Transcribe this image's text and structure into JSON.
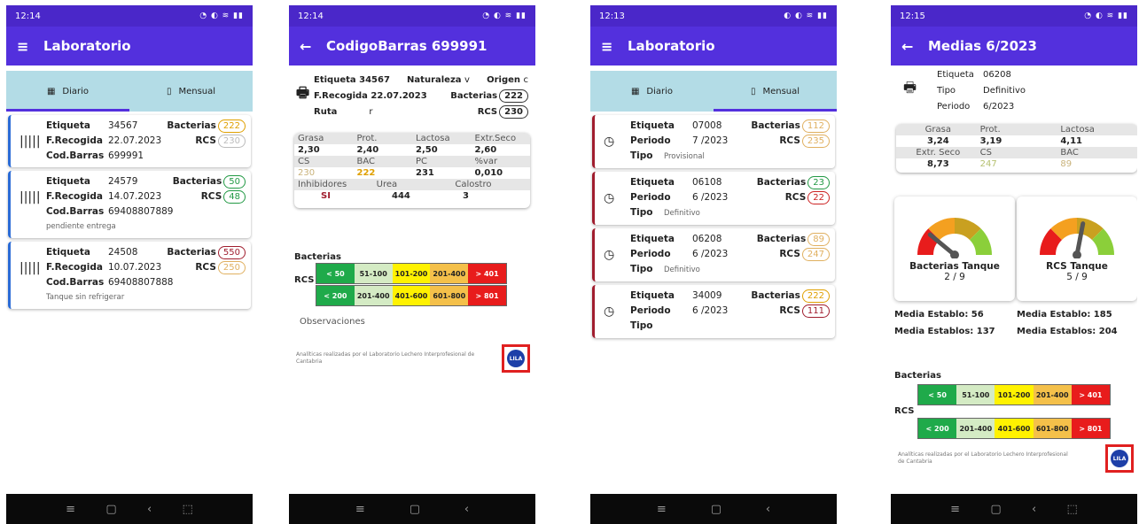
{
  "colors": {
    "primary": "#5330dd",
    "status": "#4a27c9",
    "tabbg": "#b3dce6"
  },
  "icons": {
    "menu": "≡",
    "back": "←",
    "nav_recent": "≡",
    "nav_home": "▢",
    "nav_back": "‹"
  },
  "p1": {
    "time": "12:14",
    "title": "Laboratorio",
    "tab_daily": "Diario",
    "tab_monthly": "Mensual",
    "cards": [
      {
        "etiqueta": "34567",
        "fecha": "22.07.2023",
        "codbarras": "699991",
        "bac": "222",
        "rcs": "230",
        "bac_color": "#e0a000",
        "rcs_color": "#bbb",
        "note": ""
      },
      {
        "etiqueta": "24579",
        "fecha": "14.07.2023",
        "codbarras": "69408807889",
        "bac": "50",
        "rcs": "48",
        "bac_color": "#229944",
        "rcs_color": "#229944",
        "note": "pendiente entrega"
      },
      {
        "etiqueta": "24508",
        "fecha": "10.07.2023",
        "codbarras": "69408807888",
        "bac": "550",
        "rcs": "250",
        "bac_color": "#a01d2e",
        "rcs_color": "#e0b060",
        "note": "Tanque sin refrigerar"
      }
    ]
  },
  "labels": {
    "etiqueta": "Etiqueta",
    "frecogida": "F.Recogida",
    "codbarras": "Cod.Barras",
    "bacterias": "Bacterias",
    "rcs": "RCS",
    "periodo": "Periodo",
    "tipo": "Tipo",
    "naturaleza": "Naturaleza",
    "origen": "Origen",
    "ruta": "Ruta",
    "observaciones": "Observaciones",
    "footer": "Analíticas realizadas por el Laboratorio Lechero Interprofesional de Cantabria",
    "lila": "LILA"
  },
  "p2": {
    "time": "12:14",
    "title": "CodigoBarras 699991",
    "etiqueta": "Etiqueta 34567",
    "naturaleza_val": "v",
    "origen_val": "c",
    "fecha": "F.Recogida 22.07.2023",
    "ruta_val": "r",
    "bac": "222",
    "rcs": "230",
    "h1": [
      "Grasa",
      "Prot.",
      "Lactosa",
      "Extr.Seco"
    ],
    "v1": [
      "2,30",
      "2,40",
      "2,50",
      "2,60"
    ],
    "h2": [
      "CS",
      "BAC",
      "PC",
      "%var"
    ],
    "v2": [
      "230",
      "222",
      "231",
      "0,010"
    ],
    "h3": [
      "Inhibidores",
      "Urea",
      "Calostro"
    ],
    "v3": [
      "SI",
      "444",
      "3"
    ]
  },
  "scales": {
    "bacterias": [
      "< 50",
      "51-100",
      "101-200",
      "201-400",
      "> 401"
    ],
    "rcs": [
      "< 200",
      "201-400",
      "401-600",
      "601-800",
      "> 801"
    ],
    "colors": [
      "#1faa4a",
      "#d4ebc4",
      "#fff200",
      "#f4c04a",
      "#e81c1c"
    ]
  },
  "p3": {
    "time": "12:13",
    "title": "Laboratorio",
    "cards": [
      {
        "etiqueta": "07008",
        "periodo": "7 /2023",
        "tipo": "Provisional",
        "bac": "112",
        "rcs": "235",
        "bac_color": "#e0b060",
        "rcs_color": "#e0b060"
      },
      {
        "etiqueta": "06108",
        "periodo": "6 /2023",
        "tipo": "Definitivo",
        "bac": "23",
        "rcs": "22",
        "bac_color": "#229944",
        "rcs_color": "#cc2222"
      },
      {
        "etiqueta": "06208",
        "periodo": "6 /2023",
        "tipo": "Definitivo",
        "bac": "89",
        "rcs": "247",
        "bac_color": "#e0b060",
        "rcs_color": "#e0b060"
      },
      {
        "etiqueta": "34009",
        "periodo": "6 /2023",
        "tipo": "",
        "bac": "222",
        "rcs": "111",
        "bac_color": "#e0a000",
        "rcs_color": "#a01d2e"
      }
    ]
  },
  "p4": {
    "time": "12:15",
    "title": "Medias 6/2023",
    "etiqueta": "06208",
    "tipo": "Definitivo",
    "periodo": "6/2023",
    "h1": [
      "Grasa",
      "Prot.",
      "Lactosa"
    ],
    "v1": [
      "3,24",
      "3,19",
      "4,11"
    ],
    "h2": [
      "Extr. Seco",
      "CS",
      "BAC"
    ],
    "v2": [
      "8,73",
      "247",
      "89"
    ],
    "g1_label": "Bacterias Tanque",
    "g1_val": "2 / 9",
    "g1_level": 0.22,
    "g2_label": "RCS Tanque",
    "g2_val": "5 / 9",
    "g2_level": 0.56,
    "me1": "Media Establo: 56",
    "mes1": "Media Establos: 137",
    "me2": "Media Establo: 185",
    "mes2": "Media Establos: 204"
  }
}
